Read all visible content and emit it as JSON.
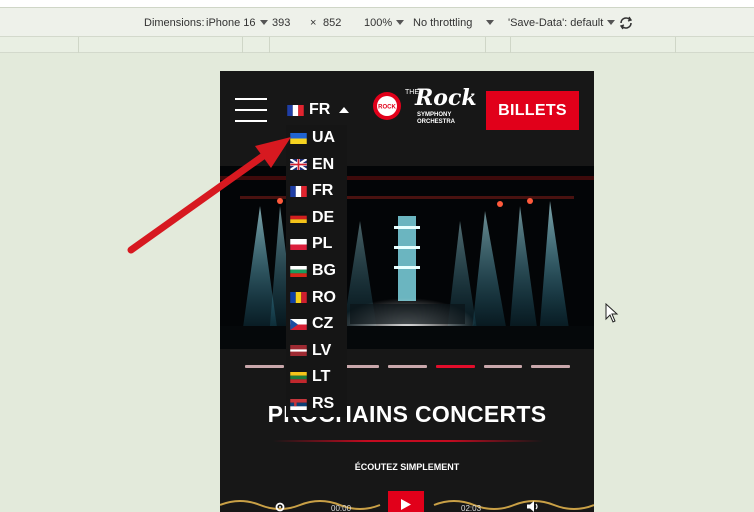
{
  "devtools": {
    "dimensions_label": "Dimensions:",
    "device": "iPhone 16",
    "width": "393",
    "times": "×",
    "height": "852",
    "zoom": "100%",
    "throttling": "No throttling",
    "save_data": "'Save-Data': default"
  },
  "site": {
    "current_lang": "FR",
    "billets_label": "BILLETS",
    "logo": {
      "word1": "THE",
      "word2": "Rock",
      "word3": "SYMPHONY",
      "word4": "ORCHESTRA",
      "badge": "ROCK"
    },
    "headline": "PROCHAINS CONCERTS",
    "listen_label": "ÉCOUTEZ SIMPLEMENT",
    "player": {
      "elapsed": "00:00",
      "duration": "02:03"
    },
    "carousel": {
      "count": 7,
      "active_index": 4
    }
  },
  "languages": [
    {
      "code": "UA",
      "flag": "ukraine-flag"
    },
    {
      "code": "EN",
      "flag": "uk-flag"
    },
    {
      "code": "FR",
      "flag": "france-flag"
    },
    {
      "code": "DE",
      "flag": "germany-flag"
    },
    {
      "code": "PL",
      "flag": "poland-flag"
    },
    {
      "code": "BG",
      "flag": "bulgaria-flag"
    },
    {
      "code": "RO",
      "flag": "romania-flag"
    },
    {
      "code": "CZ",
      "flag": "czech-flag"
    },
    {
      "code": "LV",
      "flag": "latvia-flag"
    },
    {
      "code": "LT",
      "flag": "lithuania-flag"
    },
    {
      "code": "RS",
      "flag": "serbia-flag"
    }
  ],
  "colors": {
    "accent_red": "#e1001a",
    "annotation_arrow": "#d71920",
    "page_bg": "#171717",
    "dot_active": "#e30d2b",
    "dot_inactive": "#c9a7ab"
  }
}
